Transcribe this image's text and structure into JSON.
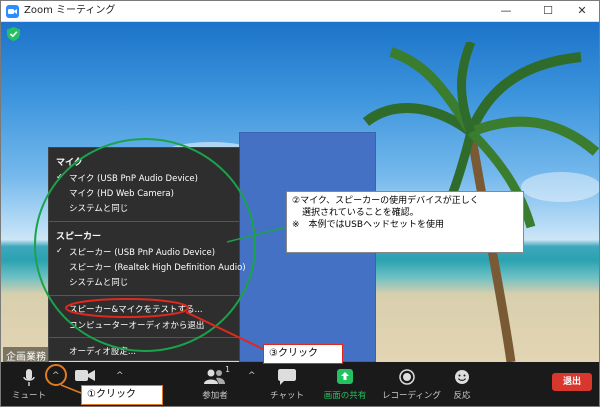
{
  "window": {
    "title": "Zoom ミーティング",
    "minimize": "—",
    "maximize": "☐",
    "close": "✕"
  },
  "meeting": {
    "participant_name": "企画業務"
  },
  "audio_menu": {
    "mic_header": "マイク",
    "mic_items": [
      "マイク (USB PnP Audio Device)",
      "マイク (HD Web Camera)",
      "システムと同じ"
    ],
    "speaker_header": "スピーカー",
    "speaker_items": [
      "スピーカー (USB PnP Audio Device)",
      "スピーカー (Realtek High Definition Audio)",
      "システムと同じ"
    ],
    "test_item": "スピーカー&マイクをテストする...",
    "computer_audio_item": "コンピューターオーディオから退出",
    "settings_item": "オーディオ設定..."
  },
  "callout": {
    "line1": "②マイク、スピーカーの使用デバイスが正しく",
    "line2": "選択されていることを確認。",
    "line3": "※　本例ではUSBヘッドセットを使用"
  },
  "labels": {
    "step1": "①クリック",
    "step3": "③クリック"
  },
  "toolbar": {
    "mute": "ミュート",
    "video": "ビ",
    "participants": "参加者",
    "participants_count": "1",
    "chat": "チャット",
    "share": "画面の共有",
    "record": "レコーディング",
    "reactions": "反応",
    "leave": "退出"
  },
  "colors": {
    "annotation_green": "#1aa34a",
    "annotation_red": "#e0281e",
    "annotation_orange": "#e07a20",
    "share_green": "#23c160",
    "leave_red": "#d8372e",
    "zoom_blue": "#2d8cff"
  }
}
